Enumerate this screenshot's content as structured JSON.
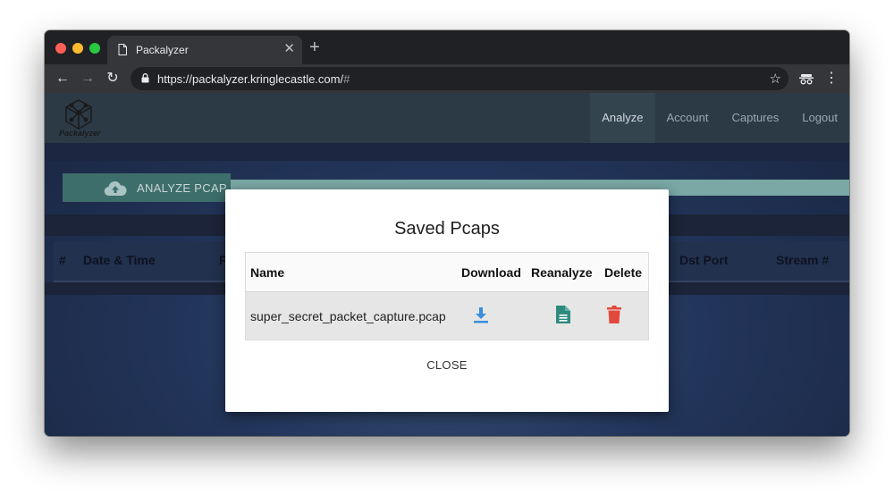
{
  "browser": {
    "tab_title": "Packalyzer",
    "url_main": "https://packalyzer.kringlecastle.com/",
    "url_hash": "#"
  },
  "site": {
    "logo_text": "Packalyzer",
    "nav": [
      "Analyze",
      "Account",
      "Captures",
      "Logout"
    ],
    "active_nav": "Analyze",
    "analyze_button": "ANALYZE PCAP",
    "table_headers": [
      "#",
      "Date & Time",
      "F",
      "Dst Port",
      "Stream #"
    ]
  },
  "modal": {
    "title": "Saved Pcaps",
    "columns": [
      "Name",
      "Download",
      "Reanalyze",
      "Delete"
    ],
    "rows": [
      {
        "name": "super_secret_packet_capture.pcap"
      }
    ],
    "close_label": "CLOSE"
  },
  "icons": {
    "download": "download-icon",
    "reanalyze": "document-icon",
    "delete": "trash-icon"
  },
  "colors": {
    "download": "#3a8fdc",
    "reanalyze": "#2f8a7e",
    "delete": "#e2493c",
    "analyze_button": "#3d6e6b"
  }
}
